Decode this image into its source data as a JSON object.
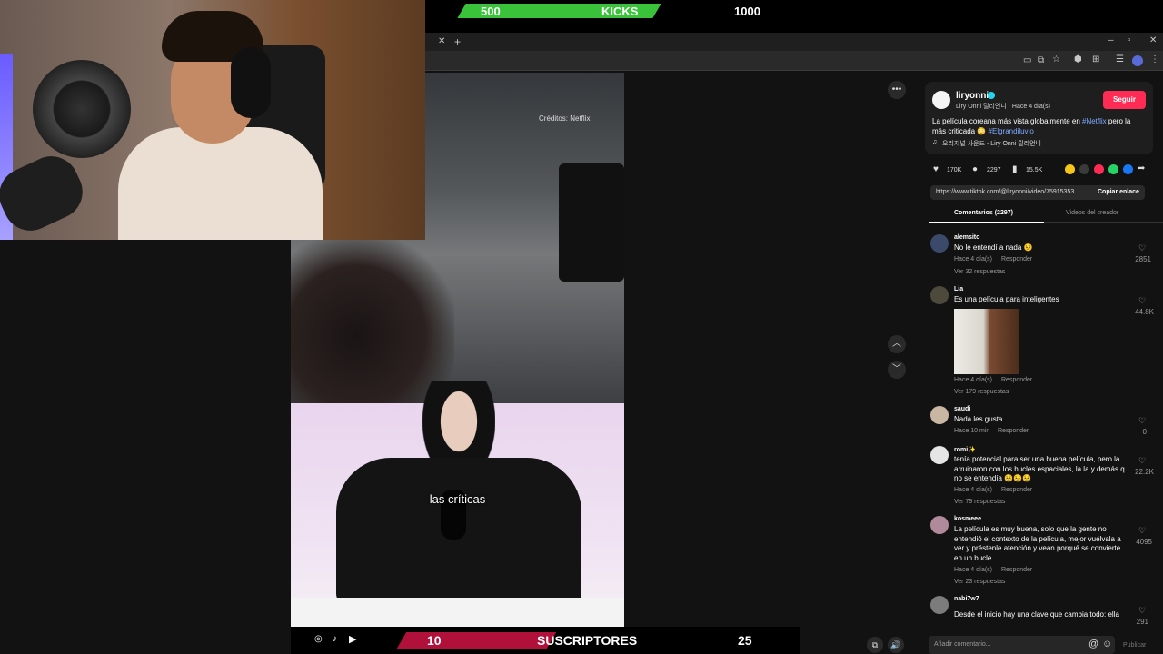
{
  "kicks_bar": {
    "current": "500",
    "label": "KICKS",
    "goal": "1000",
    "progress": 0.5
  },
  "subs_bar": {
    "current": "10",
    "label": "SUSCRIPTORES",
    "goal": "25",
    "progress": 0.4
  },
  "video": {
    "credit": "Créditos: Netflix",
    "caption": "las críticas"
  },
  "post": {
    "username": "liryonni",
    "sub": "Liry Onni 릴리언니 · Hace 4 día(s)",
    "follow": "Seguir",
    "desc_part1": "La película coreana más vista globalmente en ",
    "desc_tag1": "#Netflix",
    "desc_part2": " pero la más criticada 😳 ",
    "desc_tag2": "#Elgrandiluvio",
    "music": "오리지널 사운드 - Liry Onni 릴리언니",
    "likes": "170K",
    "comments": "2297",
    "saves": "15.5K",
    "url": "https://www.tiktok.com/@liryonni/video/75915353...",
    "copy_link": "Copiar enlace"
  },
  "tabs": {
    "comments": "Comentarios (2297)",
    "creator": "Videos del creador"
  },
  "comments": [
    {
      "name": "alemsito",
      "text": "No le entendí a nada 😣",
      "time": "Hace 4 día(s)",
      "reply": "Responder",
      "replies": "Ver 32 respuestas",
      "likes": "2851"
    },
    {
      "name": "Lia",
      "text": "Es una película para inteligentes",
      "time": "Hace 4 día(s)",
      "reply": "Responder",
      "replies": "Ver 179 respuestas",
      "likes": "44.8K"
    },
    {
      "name": "saudi",
      "text": "Nada les gusta",
      "time": "Hace 10 min",
      "reply": "Responder",
      "likes": "0"
    },
    {
      "name": "romi✨",
      "text": "tenía potencial para ser una buena película, pero la arruinaron con los bucles espaciales, la la y demás q no se entendía 😣😣😣",
      "time": "Hace 4 día(s)",
      "reply": "Responder",
      "replies": "Ver 79 respuestas",
      "likes": "22.2K"
    },
    {
      "name": "kosmeee",
      "text": "La película es muy buena, solo que la gente no entendió el contexto de la película, mejor vuélvala a ver y préstenle atención y vean porqué se convierte en un bucle",
      "time": "Hace 4 día(s)",
      "reply": "Responder",
      "replies": "Ver 23 respuestas",
      "likes": "4095"
    },
    {
      "name": "nabi7w7",
      "text": "Desde el inicio hay una clave que cambia todo: ella en realidad sí sobrevivió al diluvio, pero no a los",
      "likes": "291"
    }
  ],
  "comment_input": {
    "placeholder": "Añadir comentario...",
    "publish": "Publicar"
  }
}
